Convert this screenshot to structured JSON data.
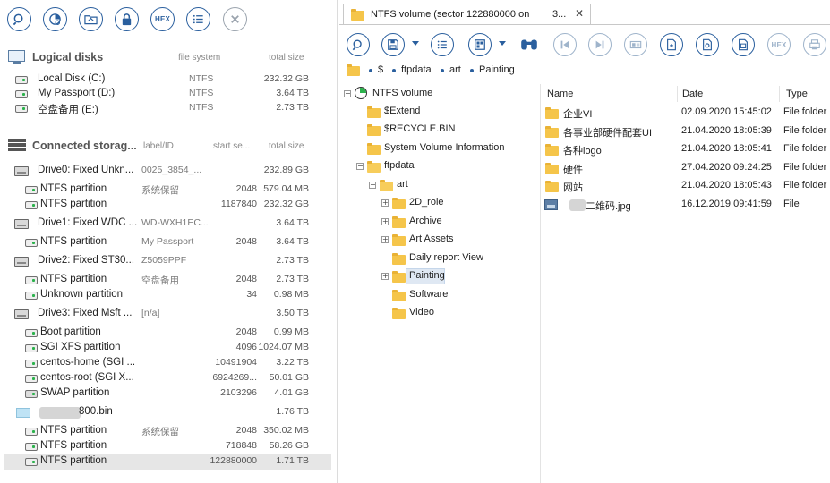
{
  "left_toolbar": [
    "search-icon",
    "scan-icon",
    "folder-tools-icon",
    "lock-icon",
    "HEX",
    "list-icon",
    "close-icon"
  ],
  "logical": {
    "title": "Logical disks",
    "col_fs": "file system",
    "col_size": "total size",
    "items": [
      {
        "name": "Local Disk (C:)",
        "fs": "NTFS",
        "size": "232.32 GB"
      },
      {
        "name": "My Passport (D:)",
        "fs": "NTFS",
        "size": "3.64 TB"
      },
      {
        "name": "空盘备用 (E:)",
        "fs": "NTFS",
        "size": "2.73 TB"
      }
    ]
  },
  "connected": {
    "title": "Connected storag...",
    "col_label": "label/ID",
    "col_start": "start se...",
    "col_size": "total size",
    "rows": [
      {
        "type": "drive",
        "name": "Drive0: Fixed Unkn...",
        "label": "0025_3854_...",
        "start": "",
        "size": "232.89 GB"
      },
      {
        "type": "part",
        "name": "NTFS partition",
        "label": "系统保留",
        "start": "2048",
        "size": "579.04 MB"
      },
      {
        "type": "part",
        "name": "NTFS partition",
        "label": "",
        "start": "1187840",
        "size": "232.32 GB"
      },
      {
        "type": "drive",
        "name": "Drive1: Fixed WDC ...",
        "label": "WD-WXH1EC...",
        "start": "",
        "size": "3.64 TB"
      },
      {
        "type": "part",
        "name": "NTFS partition",
        "label": "My Passport",
        "start": "2048",
        "size": "3.64 TB"
      },
      {
        "type": "drive",
        "name": "Drive2: Fixed ST30...",
        "label": "Z5059PPF",
        "start": "",
        "size": "2.73 TB"
      },
      {
        "type": "part",
        "name": "NTFS partition",
        "label": "空盘备用",
        "start": "2048",
        "size": "2.73 TB"
      },
      {
        "type": "part",
        "name": "Unknown partition",
        "label": "",
        "start": "34",
        "size": "0.98 MB"
      },
      {
        "type": "drive",
        "name": "Drive3: Fixed Msft ...",
        "label": "[n/a]",
        "start": "",
        "size": "3.50 TB"
      },
      {
        "type": "part",
        "name": "Boot partition",
        "label": "",
        "start": "2048",
        "size": "0.99 MB"
      },
      {
        "type": "part",
        "name": "SGI XFS partition",
        "label": "",
        "start": "4096",
        "size": "1024.07 MB"
      },
      {
        "type": "part",
        "name": "centos-home (SGI ...",
        "label": "",
        "start": "10491904",
        "size": "3.22 TB"
      },
      {
        "type": "part",
        "name": "centos-root (SGI X...",
        "label": "",
        "start": "6924269...",
        "size": "50.01 GB"
      },
      {
        "type": "swap",
        "name": "SWAP partition",
        "label": "",
        "start": "2103296",
        "size": "4.01 GB"
      },
      {
        "type": "file",
        "name": "800.bin",
        "label": "",
        "start": "",
        "size": "1.76 TB"
      },
      {
        "type": "part",
        "name": "NTFS partition",
        "label": "系统保留",
        "start": "2048",
        "size": "350.02 MB"
      },
      {
        "type": "part",
        "name": "NTFS partition",
        "label": "",
        "start": "718848",
        "size": "58.26 GB"
      },
      {
        "type": "part",
        "name": "NTFS partition",
        "label": "",
        "start": "122880000",
        "size": "1.71 TB",
        "selected": true
      }
    ]
  },
  "tab": {
    "title": "NTFS volume (sector 122880000 on",
    "title_suffix": "3...",
    "close": "✕"
  },
  "right_toolbar": [
    "search-icon",
    "save-icon",
    "list-icon",
    "view-icon",
    "binoculars-icon",
    "prev-icon",
    "next-icon",
    "id-icon",
    "file-add-icon",
    "file-settings-icon",
    "file-icon",
    "HEX",
    "print-icon"
  ],
  "breadcrumb": [
    "$",
    "ftpdata",
    "art",
    "Painting"
  ],
  "tree": {
    "root": "NTFS volume",
    "nodes": [
      {
        "label": "$Extend",
        "depth": 1,
        "expander": ""
      },
      {
        "label": "$RECYCLE.BIN",
        "depth": 1,
        "expander": ""
      },
      {
        "label": "System Volume Information",
        "depth": 1,
        "expander": ""
      },
      {
        "label": "ftpdata",
        "depth": 1,
        "expander": "−"
      },
      {
        "label": "art",
        "depth": 2,
        "expander": "−"
      },
      {
        "label": "2D_role",
        "depth": 3,
        "expander": "+"
      },
      {
        "label": "Archive",
        "depth": 3,
        "expander": "+"
      },
      {
        "label": "Art Assets",
        "depth": 3,
        "expander": "+"
      },
      {
        "label": "Daily report View",
        "depth": 3,
        "expander": ""
      },
      {
        "label": "Painting",
        "depth": 3,
        "expander": "+",
        "selected": true
      },
      {
        "label": "Software",
        "depth": 3,
        "expander": ""
      },
      {
        "label": "Video",
        "depth": 3,
        "expander": ""
      }
    ]
  },
  "files": {
    "headers": {
      "name": "Name",
      "date": "Date",
      "type": "Type"
    },
    "rows": [
      {
        "name": "企业VI",
        "date": "02.09.2020 15:45:02",
        "type": "File folder",
        "kind": "folder"
      },
      {
        "name": "各事业部硬件配套UI",
        "date": "21.04.2020 18:05:39",
        "type": "File folder",
        "kind": "folder"
      },
      {
        "name": "各种logo",
        "date": "21.04.2020 18:05:41",
        "type": "File folder",
        "kind": "folder"
      },
      {
        "name": "硬件",
        "date": "27.04.2020 09:24:25",
        "type": "File folder",
        "kind": "folder"
      },
      {
        "name": "网站",
        "date": "21.04.2020 18:05:43",
        "type": "File folder",
        "kind": "folder"
      },
      {
        "name": "二维码.jpg",
        "date": "16.12.2019 09:41:59",
        "type": "File",
        "kind": "image"
      }
    ]
  }
}
